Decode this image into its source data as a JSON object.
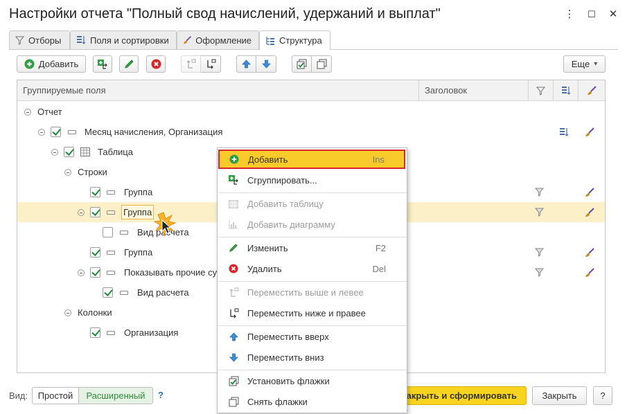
{
  "window": {
    "title": "Настройки отчета \"Полный свод начислений, удержаний и выплат\"",
    "controls": [
      "⋮",
      "☐",
      "✕"
    ]
  },
  "tabs": [
    {
      "label": "Отборы",
      "icon": "filter-icon"
    },
    {
      "label": "Поля и сортировки",
      "icon": "sort-fields-icon"
    },
    {
      "label": "Оформление",
      "icon": "brush-icon"
    },
    {
      "label": "Структура",
      "icon": "structure-icon",
      "active": true
    }
  ],
  "toolbar": {
    "add_label": "Добавить",
    "more_label": "Еще",
    "more_arrow": "▾"
  },
  "table": {
    "columns": [
      "Группируемые поля",
      "Заголовок"
    ],
    "rows": [
      {
        "label": "Отчет"
      },
      {
        "label": "Месяц начисления, Организация"
      },
      {
        "label": "Таблица"
      },
      {
        "label": "Строки"
      },
      {
        "label": "Группа"
      },
      {
        "label": "Группа",
        "selected": true
      },
      {
        "label": "Вид расчета"
      },
      {
        "label": "Группа"
      },
      {
        "label": "Показывать прочие су"
      },
      {
        "label": "Вид расчета"
      },
      {
        "label": "Колонки"
      },
      {
        "label": "Организация"
      }
    ]
  },
  "context_menu": {
    "items": [
      {
        "label": "Добавить",
        "shortcut": "Ins",
        "icon": "add-circle-icon",
        "highlighted": true
      },
      {
        "label": "Сгруппировать...",
        "shortcut": "",
        "icon": "group-icon"
      },
      {
        "label": "Добавить таблицу",
        "shortcut": "",
        "icon": "table-icon",
        "disabled": true
      },
      {
        "label": "Добавить диаграмму",
        "shortcut": "",
        "icon": "chart-icon",
        "disabled": true
      },
      {
        "label": "Изменить",
        "shortcut": "F2",
        "icon": "pencil-icon"
      },
      {
        "label": "Удалить",
        "shortcut": "Del",
        "icon": "delete-icon"
      },
      {
        "label": "Переместить выше и левее",
        "shortcut": "",
        "icon": "move-up-left-icon",
        "disabled": true
      },
      {
        "label": "Переместить ниже и правее",
        "shortcut": "",
        "icon": "move-down-right-icon"
      },
      {
        "label": "Переместить вверх",
        "shortcut": "",
        "icon": "arrow-up-icon"
      },
      {
        "label": "Переместить вниз",
        "shortcut": "",
        "icon": "arrow-down-icon"
      },
      {
        "label": "Установить флажки",
        "shortcut": "",
        "icon": "check-all-icon"
      },
      {
        "label": "Снять флажки",
        "shortcut": "",
        "icon": "uncheck-all-icon"
      }
    ]
  },
  "footer": {
    "view_label": "Вид:",
    "mode_simple": "Простой",
    "mode_extended": "Расширенный",
    "help": "?",
    "generate_label": "Закрыть и сформировать",
    "close_label": "Закрыть",
    "help_button": "?"
  },
  "colors": {
    "accent_yellow": "#f9cb2a",
    "highlight_border": "#d9262b",
    "selected_row": "#fbf0c8",
    "check_green": "#1e8a3c",
    "mode_extended_text": "#2f8a3a"
  }
}
